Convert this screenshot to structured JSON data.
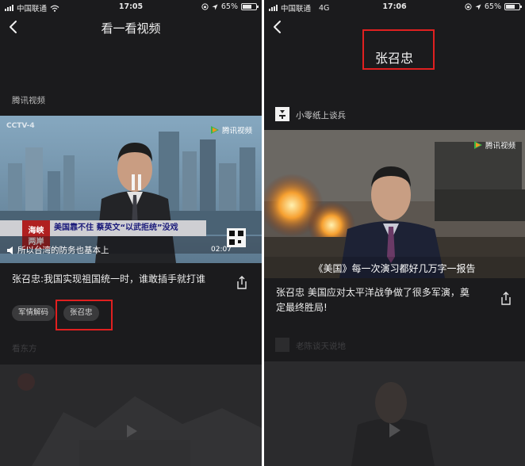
{
  "left": {
    "status": {
      "carrier": "中国联通",
      "time": "17:05",
      "battery": "65%",
      "battery_level": 0.65
    },
    "nav": {
      "title": "看一看视频"
    },
    "channel": "腾讯视频",
    "video": {
      "watermark": "腾讯视频",
      "station": "CCTV-4",
      "program_logo": "海峡两岸",
      "headline": "美国靠不住 蔡英文“以武拒统”没戏",
      "subtitle": "所以台湾的防务也基本上",
      "timestamp": "02:07"
    },
    "caption": "张召忠:我国实现祖国统一时，谁敢插手就打谁",
    "tags": [
      "军情解码",
      "张召忠"
    ],
    "next_channel": "看东方"
  },
  "right": {
    "status": {
      "carrier": "中国联通",
      "network": "4G",
      "time": "17:06",
      "battery": "65%",
      "battery_level": 0.65
    },
    "nav": {
      "title": "张召忠"
    },
    "channel": "小零纸上谈兵",
    "video": {
      "watermark": "腾讯视频",
      "subtitle": "《美国》每一次演习都好几万字一报告"
    },
    "caption": "张召忠 美国应对太平洋战争做了很多军演，奠定最终胜局!",
    "next_channel": "老陈谈天说地"
  },
  "colors": {
    "highlight": "#e02020",
    "panel": "#1b1b1d",
    "tag_bg": "#3a3a3c"
  }
}
